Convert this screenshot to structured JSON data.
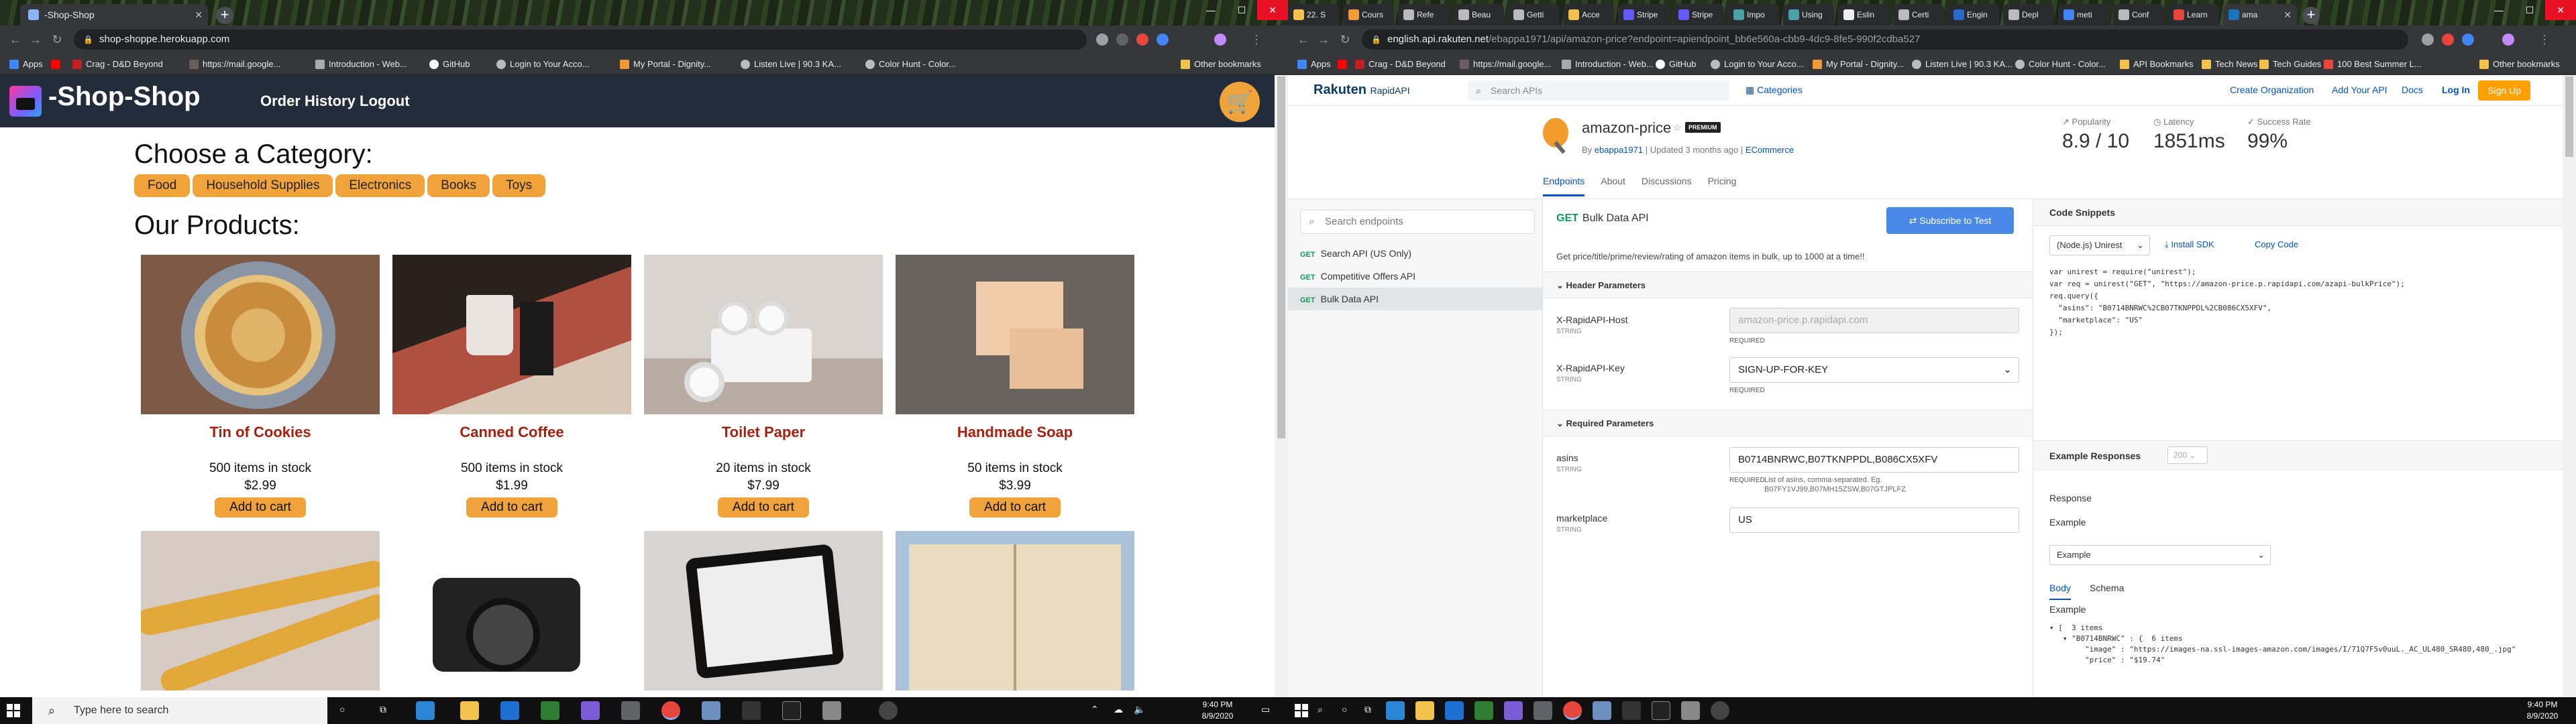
{
  "left_screen": {
    "browser": {
      "tab_title": "-Shop-Shop",
      "url": "shop-shoppe.herokuapp.com",
      "bookmarks": [
        "Apps",
        "Crag - D&D Beyond",
        "https://mail.google...",
        "Introduction - Web...",
        "GitHub",
        "Login to Your Acco...",
        "My Portal - Dignity...",
        "Listen Live | 90.3 KA...",
        "Color Hunt - Color..."
      ],
      "other_bookmarks": "Other bookmarks"
    },
    "shop": {
      "title": "-Shop-Shop",
      "nav": [
        "Order History",
        "Logout"
      ],
      "choose_heading": "Choose a Category:",
      "categories": [
        "Food",
        "Household Supplies",
        "Electronics",
        "Books",
        "Toys"
      ],
      "products_heading": "Our Products:",
      "products": [
        {
          "name": "Tin of Cookies",
          "stock": "500 items in stock",
          "price": "$2.99",
          "button": "Add to cart"
        },
        {
          "name": "Canned Coffee",
          "stock": "500 items in stock",
          "price": "$1.99",
          "button": "Add to cart"
        },
        {
          "name": "Toilet Paper",
          "stock": "20 items in stock",
          "price": "$7.99",
          "button": "Add to cart"
        },
        {
          "name": "Handmade Soap",
          "stock": "50 items in stock",
          "price": "$3.99",
          "button": "Add to cart"
        }
      ]
    },
    "taskbar": {
      "search_placeholder": "Type here to search",
      "time": "9:40 PM",
      "date": "8/9/2020"
    }
  },
  "right_screen": {
    "browser": {
      "tabs": [
        "22. S",
        "Cours",
        "Refe",
        "Beau",
        "Getti",
        "Acce",
        "Stripe",
        "Stripe",
        "Impo",
        "Using",
        "Eslin",
        "Certi",
        "Engin",
        "Depl",
        "meti",
        "Conf",
        "Learn",
        "ama"
      ],
      "url_host": "english.api.rakuten.net",
      "url_path": "/ebappa1971/api/amazon-price?endpoint=apiendpoint_bb6e560a-cbb9-4dc9-8fe5-990f2cdba527",
      "bookmarks": [
        "Apps",
        "Crag - D&D Beyond",
        "https://mail.google...",
        "Introduction - Web...",
        "GitHub",
        "Login to Your Acco...",
        "My Portal - Dignity...",
        "Listen Live | 90.3 KA...",
        "Color Hunt - Color...",
        "API Bookmarks",
        "Tech News",
        "Tech Guides",
        "100 Best Summer L..."
      ],
      "other_bookmarks": "Other bookmarks"
    },
    "rapid": {
      "logo": "Rakuten",
      "logo_sub": "RapidAPI",
      "search_placeholder": "Search APIs",
      "categories": "Categories",
      "links": [
        "Create Organization",
        "Add Your API",
        "Docs",
        "Log In"
      ],
      "signup": "Sign Up",
      "api_name": "amazon-price",
      "badge": "PREMIUM",
      "meta_by": "By",
      "meta_author": "ebappa1971",
      "meta_updated": "| Updated 3 months ago |",
      "meta_category": "ECommerce",
      "stats": [
        {
          "label": "Popularity",
          "value": "8.9 / 10"
        },
        {
          "label": "Latency",
          "value": "1851ms"
        },
        {
          "label": "Success Rate",
          "value": "99%"
        }
      ],
      "tabs": [
        "Endpoints",
        "About",
        "Discussions",
        "Pricing"
      ],
      "endpoint_search_placeholder": "Search endpoints",
      "endpoints": [
        {
          "method": "GET",
          "name": "Search API (US Only)"
        },
        {
          "method": "GET",
          "name": "Competitive Offers API"
        },
        {
          "method": "GET",
          "name": "Bulk Data API"
        }
      ],
      "selected_endpoint": {
        "method": "GET",
        "name": "Bulk Data API"
      },
      "subscribe_button": "Subscribe to Test",
      "description": "Get price/title/prime/review/rating of amazon items in bulk, up to 1000 at a time!!",
      "header_params_title": "Header Parameters",
      "header_params": [
        {
          "name": "X-RapidAPI-Host",
          "type": "STRING",
          "value": "amazon-price.p.rapidapi.com",
          "required": "REQUIRED"
        },
        {
          "name": "X-RapidAPI-Key",
          "type": "STRING",
          "value": "SIGN-UP-FOR-KEY",
          "required": "REQUIRED"
        }
      ],
      "required_params_title": "Required Parameters",
      "required_params": [
        {
          "name": "asins",
          "type": "STRING",
          "value": "B0714BNRWC,B07TKNPPDL,B086CX5XFV",
          "required": "REQUIRED",
          "note": "List of asins, comma-separated. Eg. B07FY1VJ99,B07MH15ZSW,B07GTJPLFZ"
        },
        {
          "name": "marketplace",
          "type": "STRING",
          "value": "US"
        }
      ],
      "code_title": "Code Snippets",
      "code_lang": "(Node.js) Unirest",
      "install_sdk": "Install SDK",
      "copy_code": "Copy Code",
      "code_lines": [
        "var unirest = require(\"unirest\");",
        "",
        "var req = unirest(\"GET\", \"https://amazon-price.p.rapidapi.com/azapi-bulkPrice\");",
        "",
        "req.query({",
        "  \"asins\": \"B0714BNRWC%2CB07TKNPPDL%2CB086CX5XFV\",",
        "  \"marketplace\": \"US\"",
        "});"
      ],
      "example_responses_title": "Example Responses",
      "response_code": "200",
      "response_label": "Response",
      "example_label": "Example",
      "example_dropdown": "Example",
      "response_tabs": [
        "Body",
        "Schema"
      ],
      "example_label2": "Example",
      "json_lines": [
        "▾ [  3 items",
        "   ▾ \"B0714BNRWC\" : {  6 items",
        "        \"image\" : \"https://images-na.ssl-images-amazon.com/images/I/71Q7F5v0uuL._AC_UL480_SR480,480_.jpg\"",
        "        \"price\" : \"$19.74\""
      ]
    },
    "taskbar": {
      "time": "9:40 PM",
      "date": "8/9/2020"
    }
  }
}
